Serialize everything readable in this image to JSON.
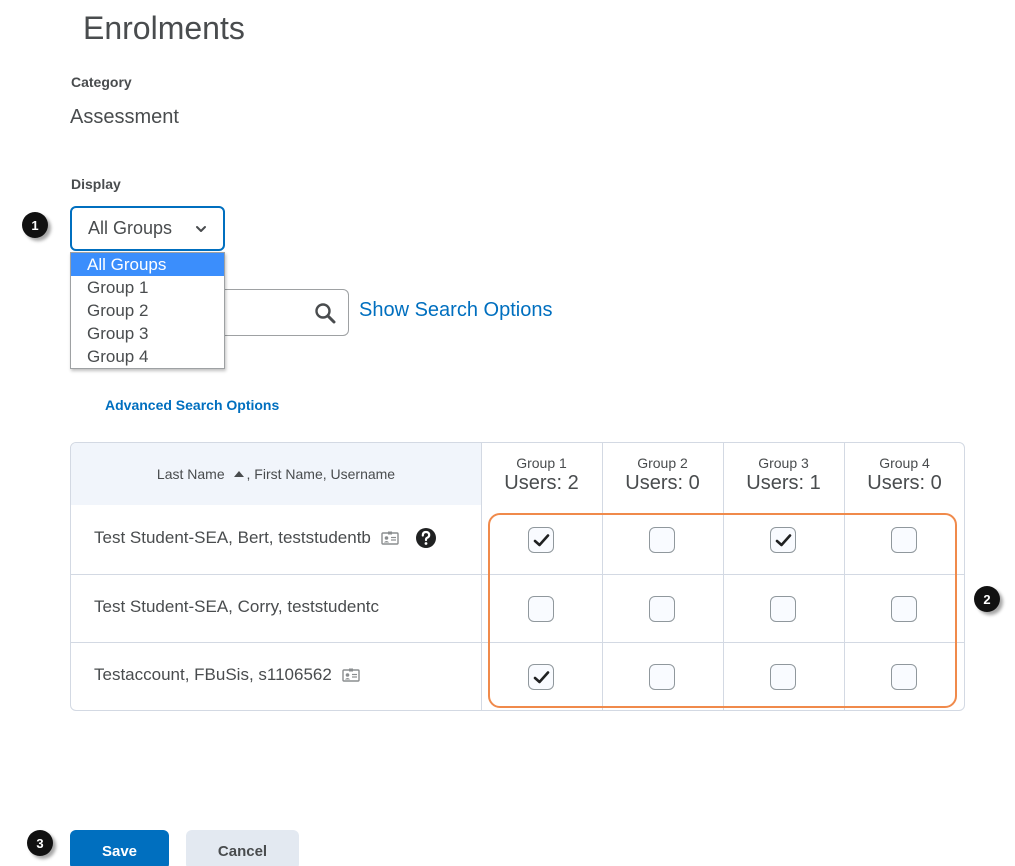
{
  "page": {
    "title": "Enrolments"
  },
  "category": {
    "label": "Category",
    "value": "Assessment"
  },
  "display": {
    "label": "Display",
    "selected": "All Groups",
    "options": [
      "All Groups",
      "Group 1",
      "Group 2",
      "Group 3",
      "Group 4"
    ]
  },
  "search": {
    "show_options_link": "Show Search Options",
    "advanced_link": "Advanced Search Options"
  },
  "table": {
    "name_header": "Last Name",
    "name_header_rest": ", First Name, Username",
    "groups": [
      {
        "name": "Group 1",
        "users": "Users: 2"
      },
      {
        "name": "Group 2",
        "users": "Users: 0"
      },
      {
        "name": "Group 3",
        "users": "Users: 1"
      },
      {
        "name": "Group 4",
        "users": "Users: 0"
      }
    ],
    "rows": [
      {
        "name": "Test Student-SEA, Bert, teststudentb",
        "checks": [
          true,
          false,
          true,
          false
        ]
      },
      {
        "name": "Test Student-SEA, Corry, teststudentc",
        "checks": [
          false,
          false,
          false,
          false
        ]
      },
      {
        "name": "Testaccount, FBuSis, s1106562",
        "checks": [
          true,
          false,
          false,
          false
        ]
      }
    ]
  },
  "callouts": [
    "1",
    "2",
    "3"
  ],
  "buttons": {
    "save": "Save",
    "cancel": "Cancel"
  },
  "colors": {
    "accent": "#006fbf",
    "highlight": "#f08a4b",
    "dropdown_selected": "#3b8efc"
  }
}
